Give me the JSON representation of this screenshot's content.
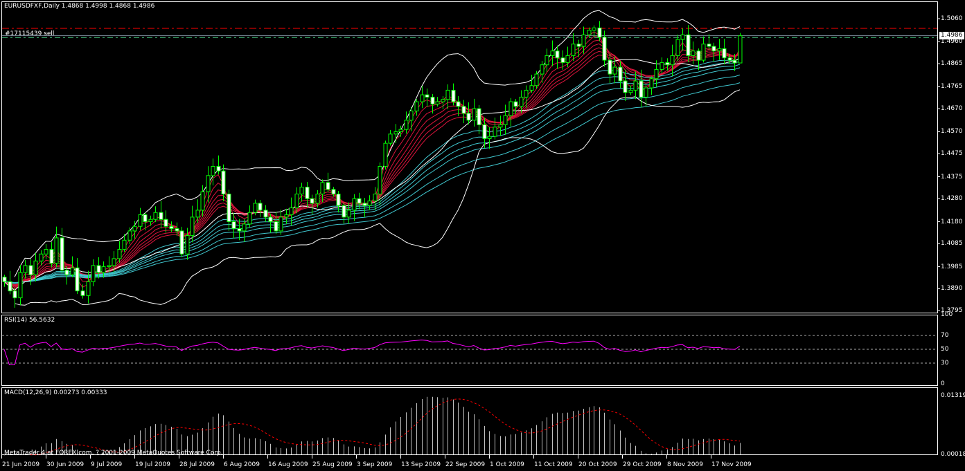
{
  "header": {
    "symbol_line": "EURUSDFXF,Daily  1.4868 1.4998 1.4868 1.4986",
    "order_label": "#17115439 sell",
    "current_price": "1.4986",
    "copyright": "MetaTrader 4 at FOREX.com, ? 2001-2009 MetaQuotes Software Corp."
  },
  "colors": {
    "background": "#000000",
    "candle_outline": "#00ff00",
    "bear_body": "#ffffff",
    "bollinger": "#ffffff",
    "fast_ma": "#dc143c",
    "slow_ma": "#40c8d0",
    "rsi": "#ff00ff",
    "macd_hist": "#c0c0c0",
    "macd_signal": "#ff0000",
    "sell_level": "#ff0000",
    "order_line": "#8090a0",
    "tp_level": "#3cb371"
  },
  "chart_data": [
    {
      "type": "candlestick",
      "title": "EURUSDFXF,Daily",
      "ylim": [
        1.3795,
        1.506
      ],
      "y_ticks": [
        "1.5060",
        "1.4960",
        "1.4865",
        "1.4765",
        "1.4670",
        "1.4570",
        "1.4475",
        "1.4375",
        "1.4280",
        "1.4180",
        "1.4085",
        "1.3985",
        "1.3890",
        "1.3795"
      ],
      "x_ticks": [
        "21 Jun 2009",
        "30 Jun 2009",
        "9 Jul 2009",
        "19 Jul 2009",
        "28 Jul 2009",
        "6 Aug 2009",
        "16 Aug 2009",
        "25 Aug 2009",
        "3 Sep 2009",
        "13 Sep 2009",
        "22 Sep 2009",
        "1 Oct 2009",
        "11 Oct 2009",
        "20 Oct 2009",
        "29 Oct 2009",
        "8 Nov 2009",
        "17 Nov 2009"
      ],
      "last_bar": {
        "open": 1.4868,
        "high": 1.4998,
        "low": 1.4868,
        "close": 1.4986
      },
      "levels": [
        {
          "name": "sell-level",
          "price": 1.5018
        },
        {
          "name": "order-line",
          "price": 1.4986
        },
        {
          "name": "tp-level",
          "price": 1.4978
        }
      ],
      "close": [
        1.392,
        1.388,
        1.385,
        1.396,
        1.399,
        1.395,
        1.401,
        1.404,
        1.406,
        1.4,
        1.411,
        1.397,
        1.395,
        1.398,
        1.388,
        1.386,
        1.392,
        1.399,
        1.396,
        1.3985,
        1.399,
        1.402,
        1.406,
        1.41,
        1.414,
        1.416,
        1.421,
        1.418,
        1.419,
        1.422,
        1.419,
        1.416,
        1.415,
        1.414,
        1.404,
        1.412,
        1.42,
        1.423,
        1.431,
        1.438,
        1.442,
        1.44,
        1.43,
        1.418,
        1.415,
        1.414,
        1.417,
        1.422,
        1.426,
        1.423,
        1.42,
        1.418,
        1.414,
        1.42,
        1.421,
        1.424,
        1.43,
        1.433,
        1.428,
        1.426,
        1.43,
        1.435,
        1.432,
        1.43,
        1.425,
        1.42,
        1.423,
        1.428,
        1.426,
        1.425,
        1.427,
        1.43,
        1.442,
        1.452,
        1.456,
        1.457,
        1.458,
        1.462,
        1.466,
        1.47,
        1.473,
        1.472,
        1.469,
        1.47,
        1.471,
        1.475,
        1.47,
        1.468,
        1.465,
        1.462,
        1.467,
        1.46,
        1.454,
        1.455,
        1.459,
        1.46,
        1.464,
        1.47,
        1.468,
        1.472,
        1.475,
        1.477,
        1.482,
        1.486,
        1.49,
        1.492,
        1.489,
        1.487,
        1.49,
        1.495,
        1.494,
        1.499,
        1.501,
        1.502,
        1.498,
        1.488,
        1.482,
        1.485,
        1.479,
        1.474,
        1.475,
        1.479,
        1.472,
        1.476,
        1.48,
        1.484,
        1.487,
        1.486,
        1.49,
        1.497,
        1.499,
        1.49,
        1.492,
        1.488,
        1.495,
        1.494,
        1.492,
        1.493,
        1.489,
        1.488,
        1.4868,
        1.4986
      ]
    },
    {
      "type": "line",
      "title": "RSI(14) 56.5632",
      "ylim": [
        0,
        100
      ],
      "y_ticks": [
        "100",
        "70",
        "50",
        "30",
        "0"
      ],
      "levels": [
        70,
        50,
        30
      ]
    },
    {
      "type": "bar",
      "title": "MACD(12,26,9) 0.00273 0.00333",
      "ylim": [
        0.00018,
        0.01319
      ],
      "y_ticks": [
        "0.01319",
        "0.00018"
      ]
    }
  ]
}
